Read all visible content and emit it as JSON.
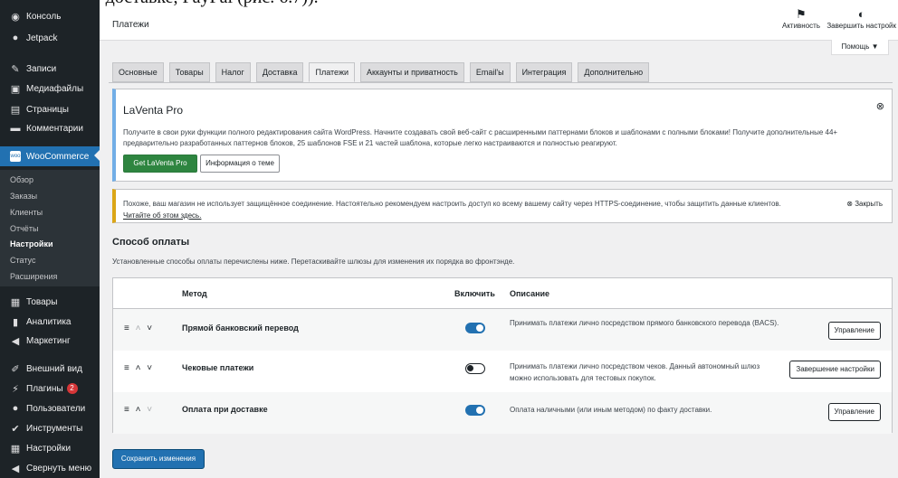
{
  "caption": "Г доставке, PayPal (рис. 6.7)).",
  "sidebar": {
    "items": [
      {
        "icon": "dashboard-icon",
        "label": "Консоль"
      },
      {
        "icon": "jetpack-icon",
        "label": "Jetpack"
      },
      {
        "icon": "pin-icon",
        "label": "Записи"
      },
      {
        "icon": "media-icon",
        "label": "Медиафайлы"
      },
      {
        "icon": "page-icon",
        "label": "Страницы"
      },
      {
        "icon": "comment-icon",
        "label": "Комментарии"
      },
      {
        "icon": "woocommerce-icon",
        "label": "WooCommerce"
      },
      {
        "icon": "products-icon",
        "label": "Товары"
      },
      {
        "icon": "analytics-icon",
        "label": "Аналитика"
      },
      {
        "icon": "marketing-icon",
        "label": "Маркетинг"
      },
      {
        "icon": "appearance-icon",
        "label": "Внешний вид"
      },
      {
        "icon": "plugins-icon",
        "label": "Плагины",
        "badge": "2"
      },
      {
        "icon": "users-icon",
        "label": "Пользователи"
      },
      {
        "icon": "tools-icon",
        "label": "Инструменты"
      },
      {
        "icon": "settings-icon",
        "label": "Настройки"
      },
      {
        "icon": "collapse-icon",
        "label": "Свернуть меню"
      }
    ],
    "submenu": [
      "Обзор",
      "Заказы",
      "Клиенты",
      "Отчёты",
      "Настройки",
      "Статус",
      "Расширения"
    ],
    "active_submenu": "Настройки"
  },
  "header": {
    "title": "Платежи",
    "activity_label": "Активность",
    "finish_setup_label": "Завершить настройк",
    "help_label": "Помощь ▼"
  },
  "tabs": [
    "Основные",
    "Товары",
    "Налог",
    "Доставка",
    "Платежи",
    "Аккаунты и приватность",
    "Email'ы",
    "Интеграция",
    "Дополнительно"
  ],
  "active_tab": "Платежи",
  "theme_notice": {
    "title": "LaVenta Pro",
    "text": "Получите в свои руки функции полного редактирования сайта WordPress. Начните создавать свой веб-сайт с расширенными паттернами блоков и шаблонами с полными блоками! Получите дополнительные 44+ предварительно разработанных паттернов блоков, 25 шаблонов FSE и 21 частей шаблона, которые легко настраиваются и полностью реагируют.",
    "primary_button": "Get LaVenta Pro",
    "secondary_button": "Информация о теме"
  },
  "ssl_notice": {
    "text": "Похоже, ваш магазин не использует защищённое соединение. Настоятельно рекомендуем настроить доступ ко всему вашему сайту через HTTPS-соединение, чтобы защитить данные клиентов.",
    "link": "Читайте об этом здесь.",
    "dismiss": "Закрыть"
  },
  "payments": {
    "title": "Способ оплаты",
    "description": "Установленные способы оплаты перечислены ниже. Перетаскивайте шлюзы для изменения их порядка во фронтэнде.",
    "columns": {
      "method": "Метод",
      "enabled": "Включить",
      "description": "Описание"
    },
    "rows": [
      {
        "name": "Прямой банковский перевод",
        "enabled": true,
        "description": "Принимать платежи лично посредством прямого банковского перевода (BACS).",
        "action": "Управление"
      },
      {
        "name": "Чековые платежи",
        "enabled": false,
        "description": "Принимать платежи лично посредством чеков. Данный автономный шлюз можно использовать для тестовых покупок.",
        "action": "Завершение настройки"
      },
      {
        "name": "Оплата при доставке",
        "enabled": true,
        "description": "Оплата наличными (или иным методом) по факту доставки.",
        "action": "Управление"
      }
    ],
    "save_button": "Сохранить изменения"
  }
}
